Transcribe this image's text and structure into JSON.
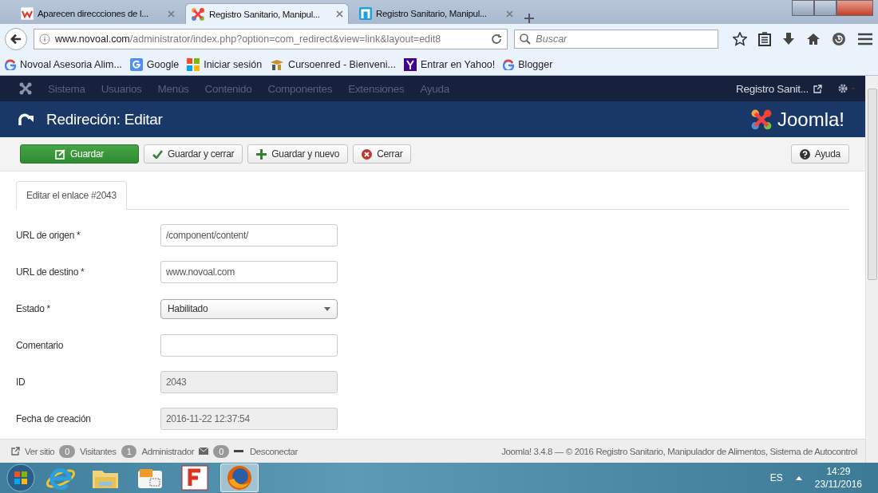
{
  "browser": {
    "tabs": [
      {
        "title": "Aparecen direccciones de l...",
        "selected": false
      },
      {
        "title": "Registro Sanitario, Manipul...",
        "selected": true
      },
      {
        "title": "Registro Sanitario, Manipul...",
        "selected": false
      }
    ],
    "url_host": "www.novoal.com",
    "url_path": "/administrator/index.php?option=com_redirect&view=link&layout=edit8",
    "search": {
      "placeholder": "Buscar"
    },
    "bookmarks": [
      {
        "label": "Novoal Asesoria Alim..."
      },
      {
        "label": "Google"
      },
      {
        "label": "Iniciar sesión"
      },
      {
        "label": "Cursoenred - Bienveni..."
      },
      {
        "label": "Entrar en Yahoo!"
      },
      {
        "label": "Blogger"
      }
    ]
  },
  "admin": {
    "menu": [
      "Sistema",
      "Usuarios",
      "Menús",
      "Contenido",
      "Componentes",
      "Extensiones",
      "Ayuda"
    ],
    "site_link": "Registro Sanit...",
    "title": "Redireción: Editar",
    "logo": "Joomla!",
    "toolbar": [
      {
        "label": "Guardar",
        "kind": "save"
      },
      {
        "label": "Guardar y cerrar",
        "kind": "check"
      },
      {
        "label": "Guardar y nuevo",
        "kind": "new"
      },
      {
        "label": "Cerrar",
        "kind": "close"
      }
    ],
    "help": "Ayuda",
    "tabs": [
      {
        "label": "Editar el enlace #2043",
        "selected": true
      }
    ],
    "fields": [
      {
        "label": "URL de origen *",
        "kind": "text",
        "value": "/component/content/"
      },
      {
        "label": "URL de destino *",
        "kind": "text",
        "value": "www.novoal.com"
      },
      {
        "label": "Estado *",
        "kind": "select",
        "value": "Habilitado"
      },
      {
        "label": "Comentario",
        "kind": "text"
      },
      {
        "label": "ID",
        "kind": "readonly",
        "value": "2043"
      },
      {
        "label": "Fecha de creación",
        "kind": "readonly",
        "value": "2016-11-22 12:37:54"
      }
    ],
    "status_bar": {
      "view_site": "Ver sitio",
      "counters": [
        {
          "count": "0",
          "label": "Visitantes"
        },
        {
          "count": "1",
          "label": "Administrador"
        },
        {
          "count": "0"
        }
      ],
      "logout": "Desconectar",
      "footer": "Joomla! 3.4.8 — © 2016 Registro Sanitario, Manipulador de Alimentos, Sistema de Autocontrol"
    }
  },
  "taskbar": {
    "apps": [
      {
        "kind": "ie",
        "selected": false
      },
      {
        "kind": "folder",
        "selected": false
      },
      {
        "kind": "app",
        "selected": false
      },
      {
        "kind": "f",
        "selected": false
      },
      {
        "kind": "firefox",
        "selected": true
      }
    ],
    "language": "ES",
    "time": "14:29",
    "date": "23/11/2016"
  }
}
